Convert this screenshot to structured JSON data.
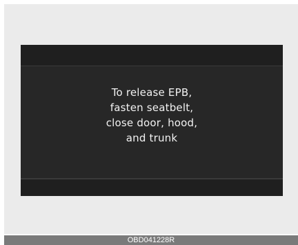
{
  "display": {
    "message_lines": [
      "To release EPB,",
      "fasten seatbelt,",
      "close door, hood,",
      "and trunk"
    ]
  },
  "caption": {
    "code": "OBD041228R"
  }
}
